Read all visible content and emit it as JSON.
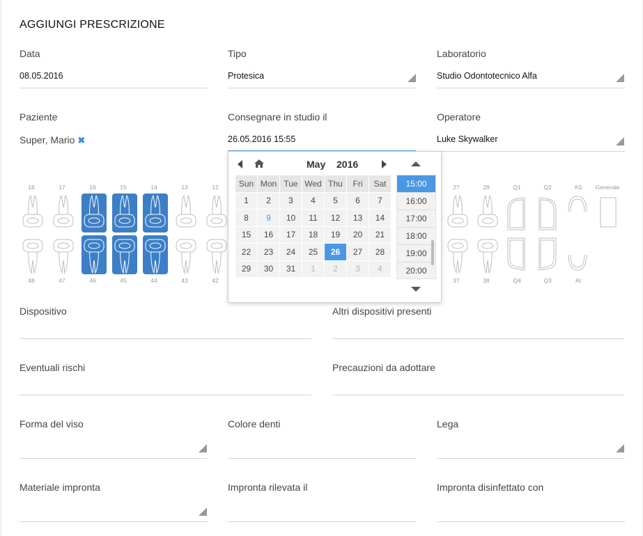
{
  "title": "AGGIUNGI PRESCRIZIONE",
  "fields": {
    "data": {
      "label": "Data",
      "value": "08.05.2016"
    },
    "tipo": {
      "label": "Tipo",
      "value": "Protesica"
    },
    "laboratorio": {
      "label": "Laboratorio",
      "value": "Studio Odontotecnico Alfa"
    },
    "paziente": {
      "label": "Paziente",
      "value": "Super, Mario"
    },
    "consegnare": {
      "label": "Consegnare in studio il",
      "value": "26.05.2016 15:55"
    },
    "operatore": {
      "label": "Operatore",
      "value": "Luke Skywalker"
    },
    "dispositivo": {
      "label": "Dispositivo",
      "value": ""
    },
    "altri": {
      "label": "Altri dispositivi presenti",
      "value": ""
    },
    "rischi": {
      "label": "Eventuali rischi",
      "value": ""
    },
    "precauzioni": {
      "label": "Precauzioni da adottare",
      "value": ""
    },
    "forma": {
      "label": "Forma del viso",
      "value": ""
    },
    "colore": {
      "label": "Colore denti",
      "value": ""
    },
    "lega": {
      "label": "Lega",
      "value": ""
    },
    "materiale": {
      "label": "Materiale impronta",
      "value": ""
    },
    "rilevata": {
      "label": "Impronta rilevata il",
      "value": ""
    },
    "disinfettato": {
      "label": "Impronta disinfettato con",
      "value": ""
    }
  },
  "teeth": {
    "upper_left": [
      "18",
      "17",
      "16",
      "15",
      "14",
      "13",
      "12"
    ],
    "lower_left": [
      "48",
      "47",
      "46",
      "45",
      "44",
      "43",
      "42"
    ],
    "upper_right": [
      "27",
      "28"
    ],
    "lower_right": [
      "37",
      "38"
    ],
    "quadrants_top": [
      "Q1",
      "Q2",
      "AS",
      "Generale"
    ],
    "quadrants_bottom": [
      "Q4",
      "Q3",
      "AI"
    ],
    "selected": [
      "16",
      "15",
      "14",
      "46",
      "45",
      "44"
    ]
  },
  "datepicker": {
    "month": "May",
    "year": "2016",
    "weekdays": [
      "Sun",
      "Mon",
      "Tue",
      "Wed",
      "Thu",
      "Fri",
      "Sat"
    ],
    "weeks": [
      [
        "1",
        "2",
        "3",
        "4",
        "5",
        "6",
        "7"
      ],
      [
        "8",
        "9",
        "10",
        "11",
        "12",
        "13",
        "14"
      ],
      [
        "15",
        "16",
        "17",
        "18",
        "19",
        "20",
        "21"
      ],
      [
        "22",
        "23",
        "24",
        "25",
        "26",
        "27",
        "28"
      ],
      [
        "29",
        "30",
        "31",
        "1",
        "2",
        "3",
        "4"
      ]
    ],
    "today": "9",
    "selected_day": "26",
    "times": [
      "15:00",
      "16:00",
      "17:00",
      "18:00",
      "19:00",
      "20:00"
    ],
    "selected_time": "15:00"
  },
  "colors": {
    "accent": "#4a98e4",
    "tooth_selected": "#3d7fc7",
    "today": "#3d9be8"
  }
}
